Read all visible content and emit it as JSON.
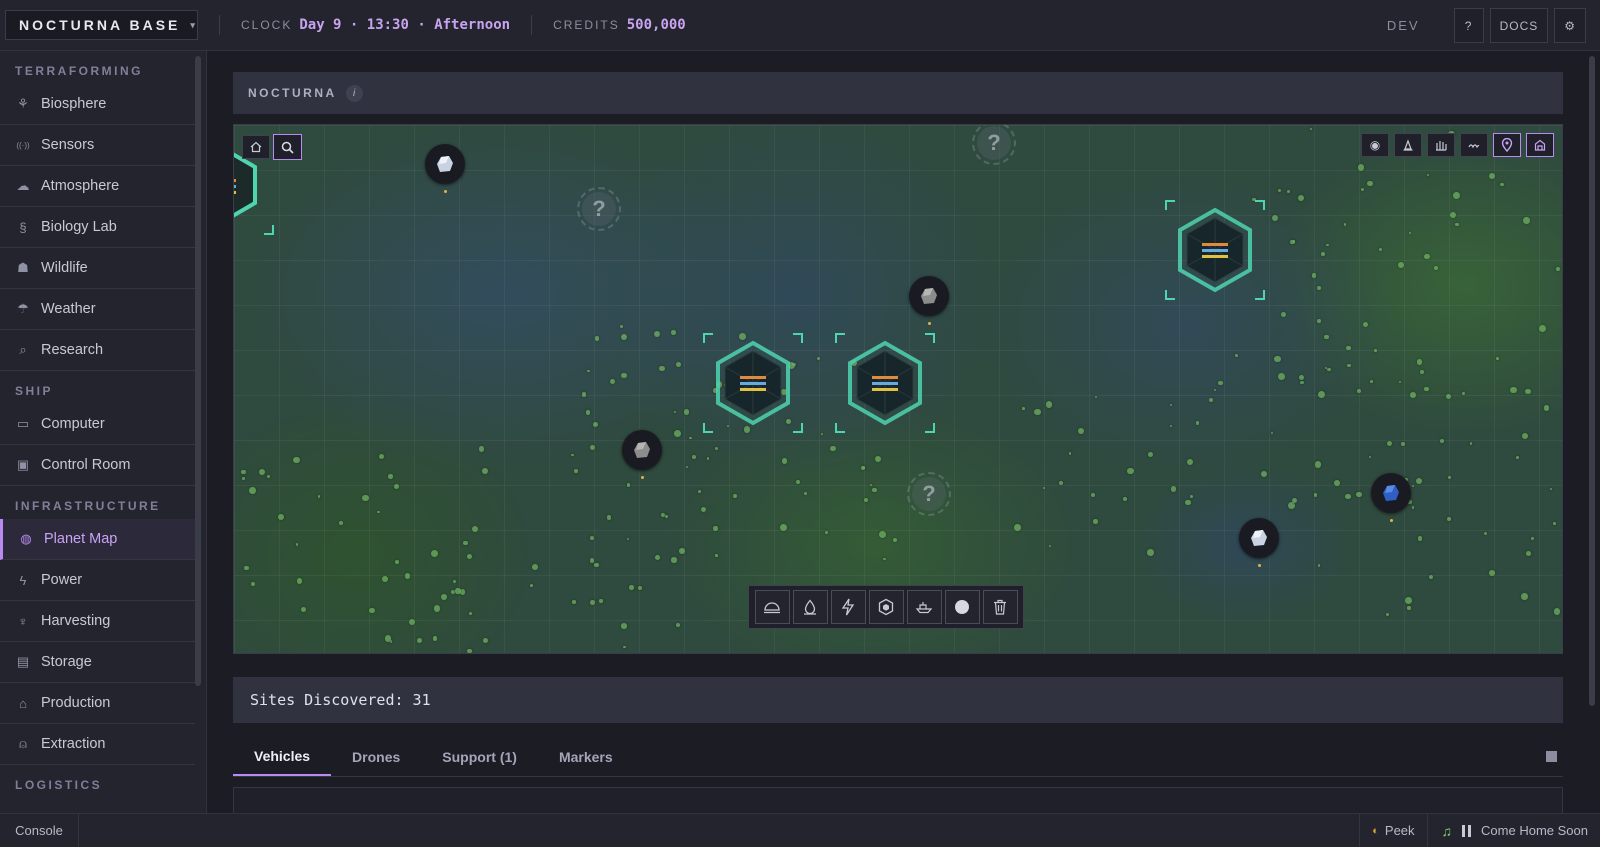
{
  "topbar": {
    "base_name": "NOCTURNA BASE",
    "clock_label": "CLOCK",
    "clock_value": "Day 9 · 13:30 · Afternoon",
    "credits_label": "CREDITS",
    "credits_value": "500,000",
    "dev_label": "DEV",
    "help_label": "?",
    "docs_label": "DOCS",
    "settings_icon": "gear-icon"
  },
  "sidebar": {
    "sections": [
      {
        "title": "TERRAFORMING",
        "items": [
          {
            "label": "Biosphere",
            "icon": "sprout-icon"
          },
          {
            "label": "Sensors",
            "icon": "signal-icon"
          },
          {
            "label": "Atmosphere",
            "icon": "cloud-layers-icon"
          },
          {
            "label": "Biology Lab",
            "icon": "dna-icon"
          },
          {
            "label": "Wildlife",
            "icon": "animal-icon"
          },
          {
            "label": "Weather",
            "icon": "rain-cloud-icon"
          },
          {
            "label": "Research",
            "icon": "research-icon"
          }
        ]
      },
      {
        "title": "SHIP",
        "items": [
          {
            "label": "Computer",
            "icon": "monitor-icon"
          },
          {
            "label": "Control Room",
            "icon": "panel-icon"
          }
        ]
      },
      {
        "title": "INFRASTRUCTURE",
        "items": [
          {
            "label": "Planet Map",
            "icon": "globe-icon",
            "active": true
          },
          {
            "label": "Power",
            "icon": "bolt-icon"
          },
          {
            "label": "Harvesting",
            "icon": "harvest-icon"
          },
          {
            "label": "Storage",
            "icon": "boxes-icon"
          },
          {
            "label": "Production",
            "icon": "factory-icon"
          },
          {
            "label": "Extraction",
            "icon": "drill-icon"
          }
        ]
      },
      {
        "title": "LOGISTICS",
        "items": []
      }
    ]
  },
  "map": {
    "title": "NOCTURNA",
    "info_icon": "info-icon",
    "left_controls": [
      "home-icon",
      "search-icon"
    ],
    "right_controls": [
      "eye-icon",
      "beacon-icon",
      "city-icon",
      "waves-icon",
      "pin-icon",
      "base-icon"
    ],
    "active_right_controls": [
      "pin-icon",
      "base-icon"
    ],
    "unknown_marker": "?",
    "toolbar": [
      "dome-icon",
      "water-drop-icon",
      "bolt-icon",
      "hex-icon",
      "ship-icon",
      "circle-icon",
      "trash-icon"
    ],
    "colors": {
      "site_outline": "#4fd4b0",
      "stripe_orange": "#e08a3c",
      "stripe_yellow": "#e0c040",
      "stripe_blue": "#6aa8e0",
      "accent": "#b98bf2"
    }
  },
  "sites": {
    "label": "Sites Discovered: 31"
  },
  "tabs": [
    {
      "label": "Vehicles",
      "active": true
    },
    {
      "label": "Drones"
    },
    {
      "label": "Support (1)"
    },
    {
      "label": "Markers"
    }
  ],
  "bottombar": {
    "console_label": "Console",
    "peek_label": "Peek",
    "track_name": "Come Home Soon"
  }
}
